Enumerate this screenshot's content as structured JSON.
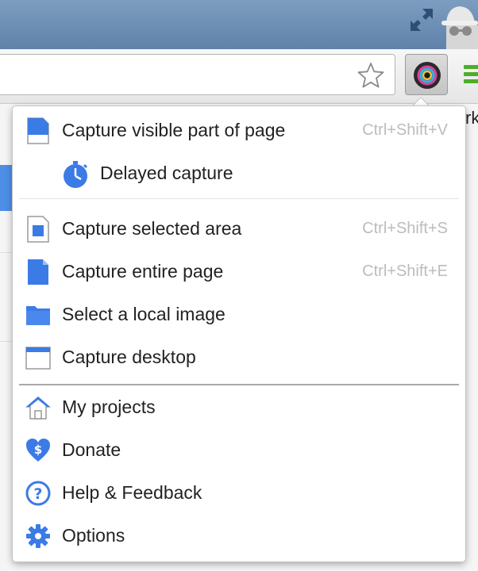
{
  "toolbar": {
    "bookmark_partial": "rk"
  },
  "menu": {
    "group1": [
      {
        "label": "Capture visible part of page",
        "shortcut": "Ctrl+Shift+V",
        "icon": "visible-page-icon"
      },
      {
        "label": "Delayed capture",
        "shortcut": "",
        "icon": "timer-icon"
      }
    ],
    "group2": [
      {
        "label": "Capture selected area",
        "shortcut": "Ctrl+Shift+S",
        "icon": "selected-area-icon"
      },
      {
        "label": "Capture entire page",
        "shortcut": "Ctrl+Shift+E",
        "icon": "entire-page-icon"
      },
      {
        "label": "Select a local image",
        "shortcut": "",
        "icon": "folder-icon"
      },
      {
        "label": "Capture desktop",
        "shortcut": "",
        "icon": "desktop-window-icon"
      }
    ],
    "group3": [
      {
        "label": "My projects",
        "icon": "home-icon"
      },
      {
        "label": "Donate",
        "icon": "heart-dollar-icon"
      },
      {
        "label": "Help & Feedback",
        "icon": "help-icon"
      },
      {
        "label": "Options",
        "icon": "gear-icon"
      }
    ]
  },
  "colors": {
    "icon_blue": "#3b7be6",
    "shortcut_gray": "#bcbcbc",
    "titlebar": "#6f90b8",
    "menu_green": "#4cae29"
  }
}
